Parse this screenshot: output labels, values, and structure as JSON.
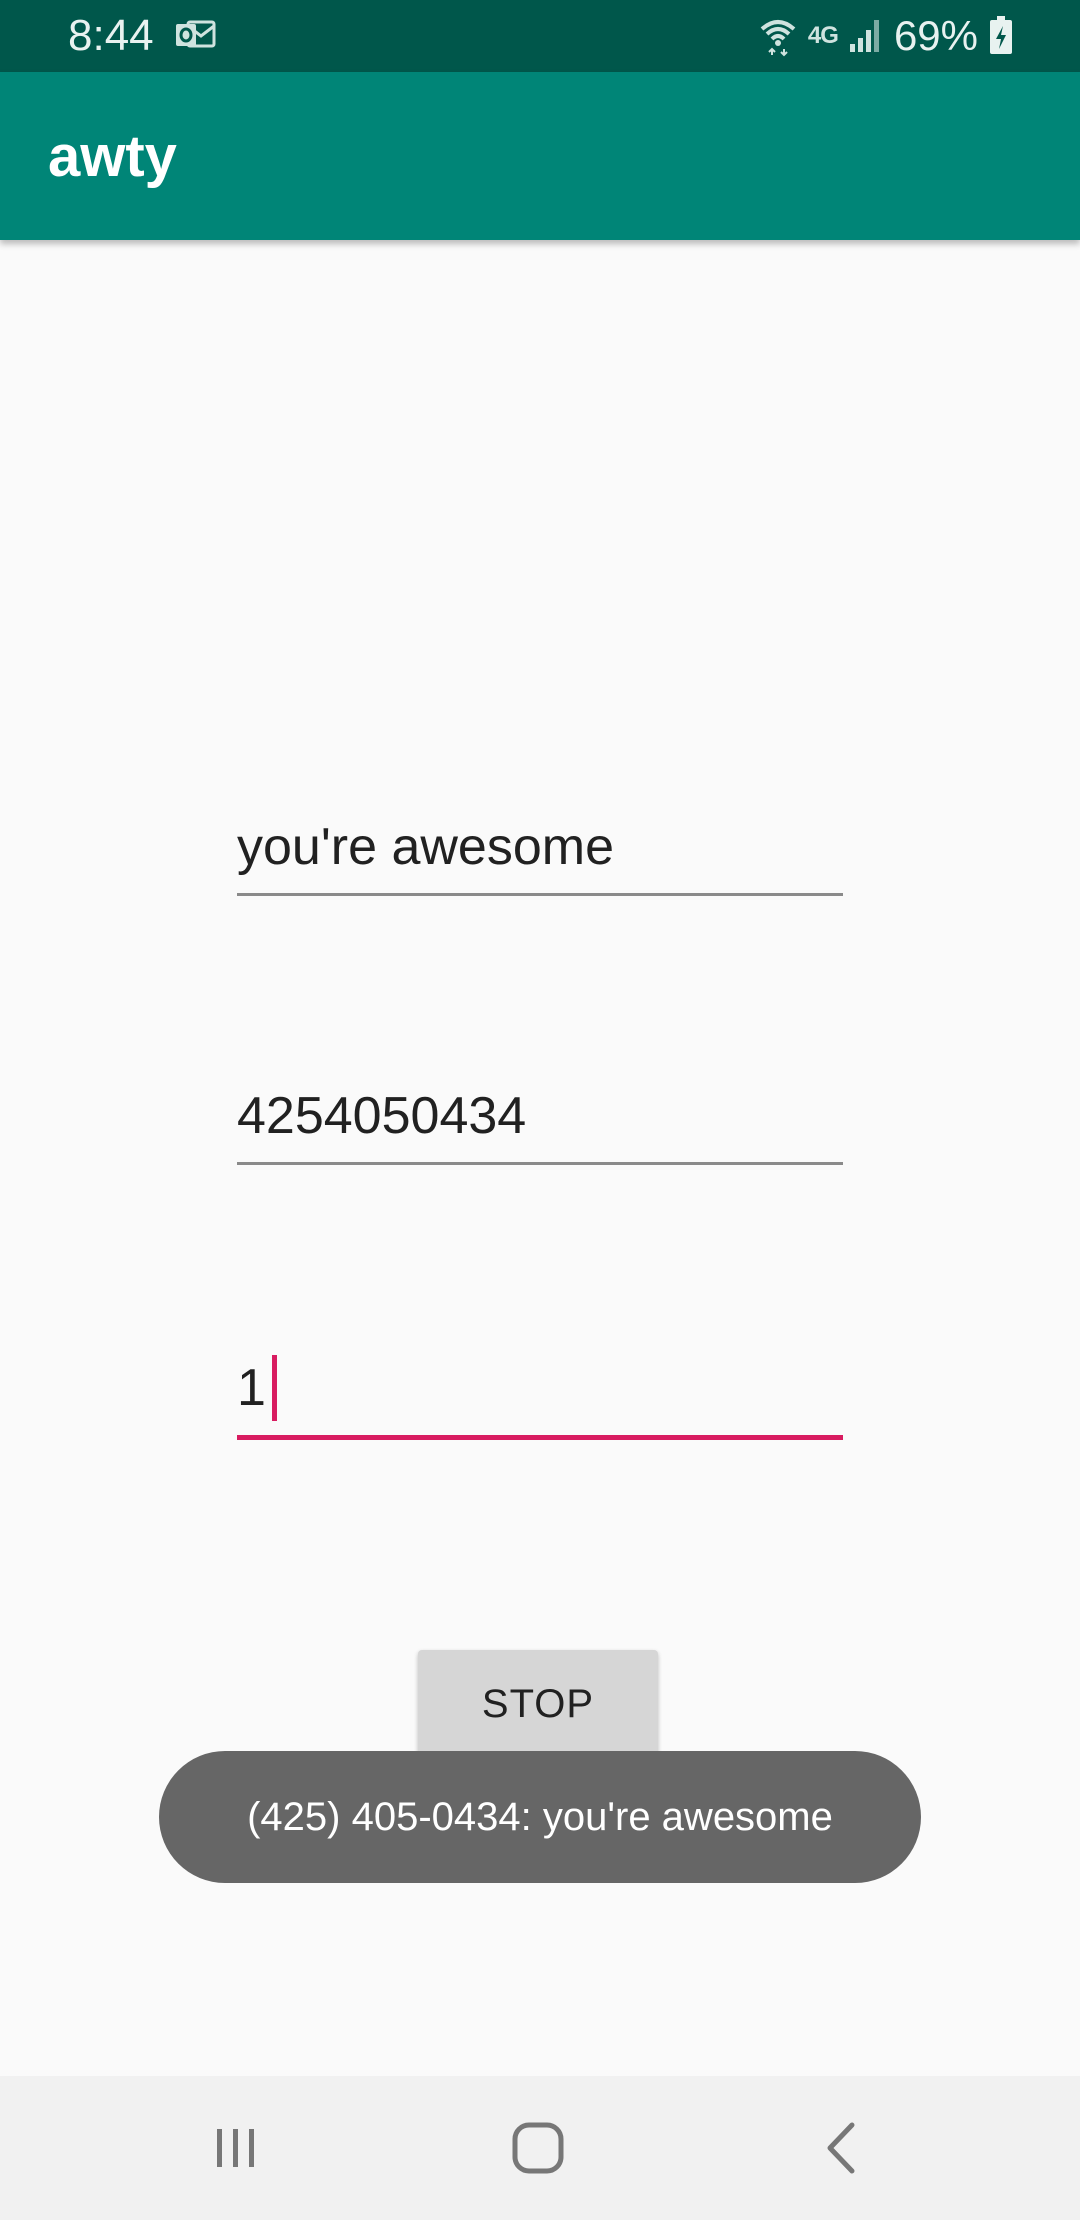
{
  "status_bar": {
    "time": "8:44",
    "network_type": "4G",
    "battery_percent": "69%",
    "icons": [
      "outlook-notification-icon",
      "wifi-icon",
      "signal-icon",
      "battery-charging-icon"
    ]
  },
  "app_bar": {
    "title": "awty"
  },
  "form": {
    "message_value": "you're awesome",
    "phone_value": "4254050434",
    "interval_value": "1"
  },
  "stop_button": {
    "label": "STOP"
  },
  "toast": {
    "text": "(425) 405-0434: you're awesome"
  },
  "nav_bar": {
    "icons": [
      "recent-apps-icon",
      "home-icon",
      "back-icon"
    ]
  },
  "colors": {
    "status_bar": "#00574b",
    "app_bar": "#008577",
    "accent": "#d81b60",
    "background": "#fafafa",
    "toast": "#666666",
    "button": "#d6d6d6"
  }
}
